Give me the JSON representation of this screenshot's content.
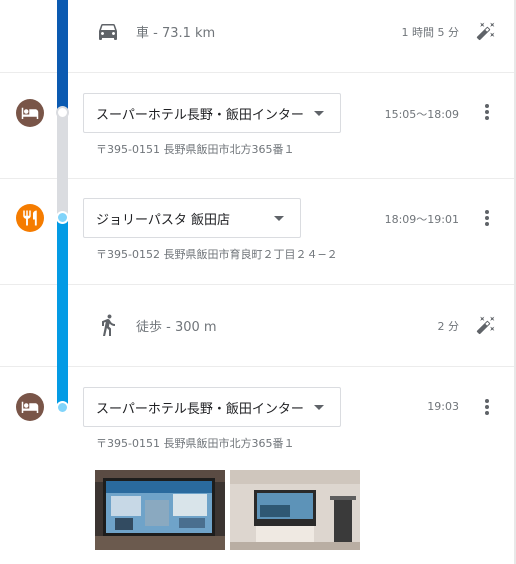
{
  "legs": [
    {
      "mode_icon": "car-icon",
      "label": "車 - 73.1 km",
      "duration": "1 時間 5 分",
      "action_icon": "magic-wand-icon"
    },
    {
      "mode_icon": "walking-icon",
      "label": "徒歩 - 300 m",
      "duration": "2 分",
      "action_icon": "magic-wand-icon"
    }
  ],
  "stops": [
    {
      "category_icon": "hotel-icon",
      "category_color": "#795548",
      "name": "スーパーホテル長野・飯田インター",
      "address": "〒395-0151 長野県飯田市北方365番１",
      "time": "15:05～18:09"
    },
    {
      "category_icon": "restaurant-icon",
      "category_color": "#f57c00",
      "name": "ジョリーパスタ 飯田店",
      "address": "〒395-0152 長野県飯田市育良町２丁目２４−２",
      "time": "18:09～19:01"
    },
    {
      "category_icon": "hotel-icon",
      "category_color": "#795548",
      "name": "スーパーホテル長野・飯田インター",
      "address": "〒395-0151 長野県飯田市北方365番１",
      "time": "19:03"
    }
  ],
  "colors": {
    "route_dark": "#0b5ab1",
    "route_light": "#039be5",
    "route_inactive": "#dadce0"
  }
}
